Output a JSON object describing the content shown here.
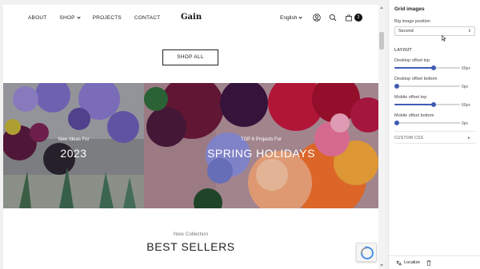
{
  "header": {
    "nav": [
      "ABOUT",
      "SHOP",
      "PROJECTS",
      "CONTACT"
    ],
    "logo": "Gain",
    "language": "English",
    "cart_count": "2"
  },
  "main": {
    "shop_all_label": "SHOP ALL",
    "banners": [
      {
        "subtitle": "New Ideas For",
        "title": "2023"
      },
      {
        "subtitle": "TOP 6 Projects For",
        "title": "SPRING HOLIDAYS"
      }
    ],
    "collection_subtitle": "New Collection",
    "collection_title": "BEST SELLERS"
  },
  "panel": {
    "title": "Grid images",
    "big_image_position_label": "Big image position",
    "big_image_position_value": "Second",
    "layout_label": "LAYOUT",
    "sliders": [
      {
        "label": "Desktop offset top",
        "value": 60,
        "unit": "px",
        "display": "60px"
      },
      {
        "label": "Desktop offset bottom",
        "value": 0,
        "unit": "px",
        "display": "0px"
      },
      {
        "label": "Mobile offset top",
        "value": 60,
        "unit": "px",
        "display": "60px"
      },
      {
        "label": "Mobile offset bottom",
        "value": 0,
        "unit": "px",
        "display": "0px"
      }
    ],
    "custom_css_label": "CUSTOM CSS",
    "localize_label": "Localize"
  },
  "colors": {
    "accent": "#3f5bb3",
    "text": "#222222"
  }
}
